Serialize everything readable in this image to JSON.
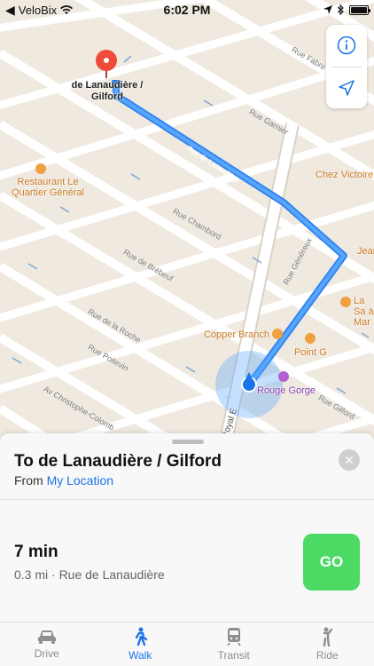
{
  "status_bar": {
    "back_app": "VeloBix",
    "time": "6:02 PM"
  },
  "map": {
    "pin_label": "de Lanaudière / Gilford",
    "pois": [
      {
        "name": "Restaurant Le Quartier Général",
        "color": "#c9771f"
      },
      {
        "name": "Chez Victoire",
        "color": "#c9771f"
      },
      {
        "name": "Jean",
        "color": "#c9771f"
      },
      {
        "name": "La Sa à Mar",
        "color": "#c9771f"
      },
      {
        "name": "Copper Branch",
        "color": "#c9771f"
      },
      {
        "name": "Point G",
        "color": "#c9771f"
      },
      {
        "name": "Rouge Gorge",
        "color": "#8b3fb0"
      }
    ],
    "streets": [
      "Rue Fabre",
      "Rue Garnier",
      "Rue de Lanaudière",
      "Rue Chambord",
      "Rue de Brébeuf",
      "Rue de la Roche",
      "Rue Poitevin",
      "Av Christophe-Colomb",
      "Rue Gilford",
      "Rue Généreux",
      "Royal E"
    ],
    "route_color": "#3b8ff5",
    "location_color": "#1a73e8",
    "controls": {
      "info_icon": "info-icon",
      "location_icon": "location-arrow-icon"
    }
  },
  "sheet": {
    "title": "To de Lanaudière / Gilford",
    "from_label": "From",
    "from_value": "My Location",
    "duration": "7 min",
    "details": "0.3 mi · Rue de Lanaudière",
    "go_label": "GO",
    "go_color": "#4cd964"
  },
  "tabs": [
    {
      "label": "Drive",
      "icon": "car-icon",
      "active": false
    },
    {
      "label": "Walk",
      "icon": "walk-icon",
      "active": true
    },
    {
      "label": "Transit",
      "icon": "train-icon",
      "active": false
    },
    {
      "label": "Ride",
      "icon": "ride-icon",
      "active": false
    }
  ]
}
